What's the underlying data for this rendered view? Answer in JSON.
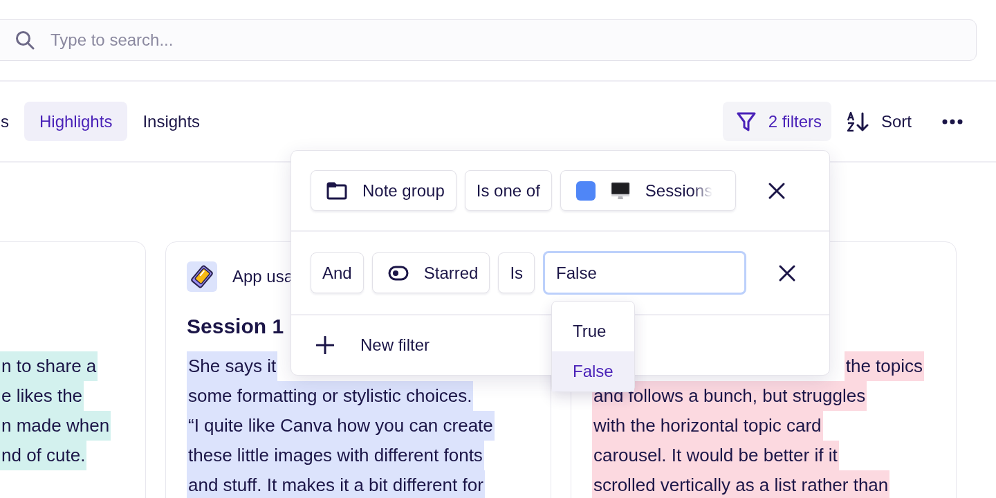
{
  "search": {
    "placeholder": "Type to search..."
  },
  "tabs": [
    {
      "label": "s",
      "selected": false
    },
    {
      "label": "Highlights",
      "selected": true
    },
    {
      "label": "Insights",
      "selected": false
    }
  ],
  "toolbar": {
    "filter_button": {
      "label": "2 filters",
      "active": true
    },
    "sort_button": {
      "label": "Sort"
    }
  },
  "cards": [
    {
      "color": "#d3f1ee",
      "lines": [
        "n to share a",
        "e likes the",
        "n made when",
        "nd of cute."
      ]
    },
    {
      "header": "App usa",
      "title": "Session 1",
      "color": "#dce3fc",
      "lines": [
        "She says it",
        "some formatting or stylistic choices.",
        "“I quite like Canva how you can create",
        "these little images with different fonts",
        "and stuff. It makes it a bit different for"
      ]
    },
    {
      "color": "#fcd9e0",
      "lines": [
        "the topics",
        "and follows a bunch, but struggles",
        "with the horizontal topic card",
        "carousel. It would be better if it",
        "scrolled vertically as a list rather than"
      ]
    }
  ],
  "filter_popover": {
    "filters": [
      {
        "field": "Note group",
        "operator": "Is one of",
        "value": {
          "kind": "chip",
          "label": "Sessions"
        }
      },
      {
        "conjunction": "And",
        "field": "Starred",
        "operator": "Is",
        "value": {
          "kind": "select",
          "label": "False",
          "focused": true
        }
      }
    ],
    "new_filter": {
      "label": "New filter"
    }
  },
  "dropdown": {
    "options": [
      {
        "label": "True",
        "selected": false
      },
      {
        "label": "False",
        "selected": true
      }
    ]
  }
}
